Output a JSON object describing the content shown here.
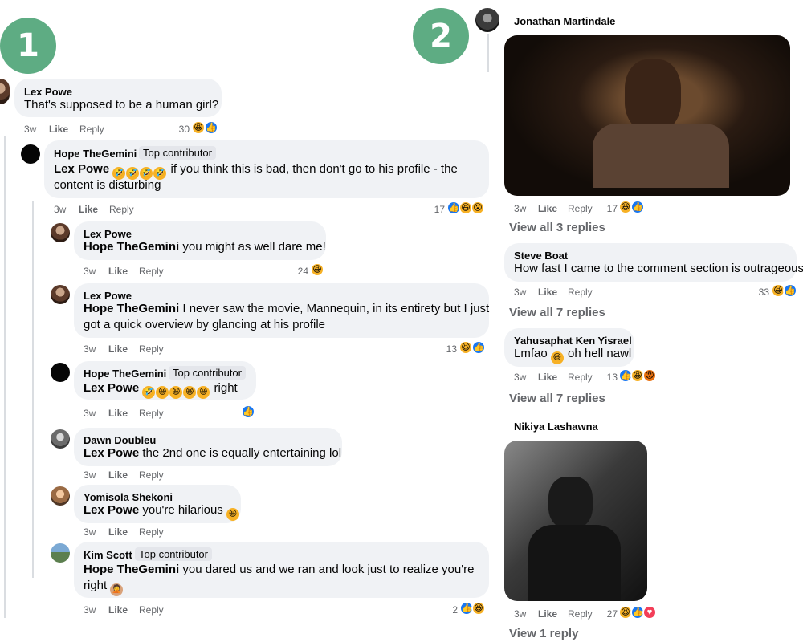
{
  "panels": [
    {
      "number": "1"
    },
    {
      "number": "2"
    }
  ],
  "left": {
    "top": {
      "author": "Lex Powe",
      "text": "That's supposed to be a human girl?",
      "time": "3w",
      "like": "Like",
      "reply": "Reply",
      "count": "30"
    },
    "replies": [
      {
        "author": "Hope TheGemini",
        "badge": "Top contributor",
        "mention": "Lex Powe",
        "text_line1": " if you think this is bad, then don't go to his profile - the",
        "text_line2": "content is disturbing",
        "time": "3w",
        "like": "Like",
        "reply": "Reply",
        "count": "17"
      },
      {
        "author": "Lex Powe",
        "mention": "Hope TheGemini",
        "text": " you might as well dare me!",
        "time": "3w",
        "like": "Like",
        "reply": "Reply",
        "count": "24"
      },
      {
        "author": "Lex Powe",
        "mention": "Hope TheGemini",
        "text_line1": " I never saw the movie, Mannequin, in its entirety but I just",
        "text_line2": "got a quick overview by glancing at his profile",
        "time": "3w",
        "like": "Like",
        "reply": "Reply",
        "count": "13"
      },
      {
        "author": "Hope TheGemini",
        "badge": "Top contributor",
        "mention": "Lex Powe",
        "text": " right",
        "time": "3w",
        "like": "Like",
        "reply": "Reply"
      },
      {
        "author": "Dawn Doubleu",
        "mention": "Lex Powe",
        "text": " the 2nd one is equally entertaining lol",
        "time": "3w",
        "like": "Like",
        "reply": "Reply"
      },
      {
        "author": "Yomisola Shekoni",
        "mention": "Lex Powe",
        "text": " you're hilarious ",
        "time": "3w",
        "like": "Like",
        "reply": "Reply"
      },
      {
        "author": "Kim Scott",
        "badge": "Top contributor",
        "mention": "Hope TheGemini",
        "text_line1": " you dared us and we ran and look just to realize you're",
        "text_line2": "right ",
        "time": "3w",
        "like": "Like",
        "reply": "Reply",
        "count": "2"
      }
    ]
  },
  "right": {
    "items": [
      {
        "author": "Jonathan Martindale",
        "time": "3w",
        "like": "Like",
        "reply": "Reply",
        "count": "17",
        "view": "View all 3 replies"
      },
      {
        "author": "Steve Boat",
        "text": "How fast I came to the comment section is outrageous",
        "time": "3w",
        "like": "Like",
        "reply": "Reply",
        "count": "33",
        "view": "View all 7 replies"
      },
      {
        "author": "Yahusaphat Ken Yisrael",
        "text_a": "Lmfao ",
        "text_b": " oh hell nawl",
        "time": "3w",
        "like": "Like",
        "reply": "Reply",
        "count": "13",
        "view": "View all 7 replies"
      },
      {
        "author": "Nikiya Lashawna",
        "time": "3w",
        "like": "Like",
        "reply": "Reply",
        "count": "27",
        "view": "View 1 reply"
      }
    ]
  }
}
